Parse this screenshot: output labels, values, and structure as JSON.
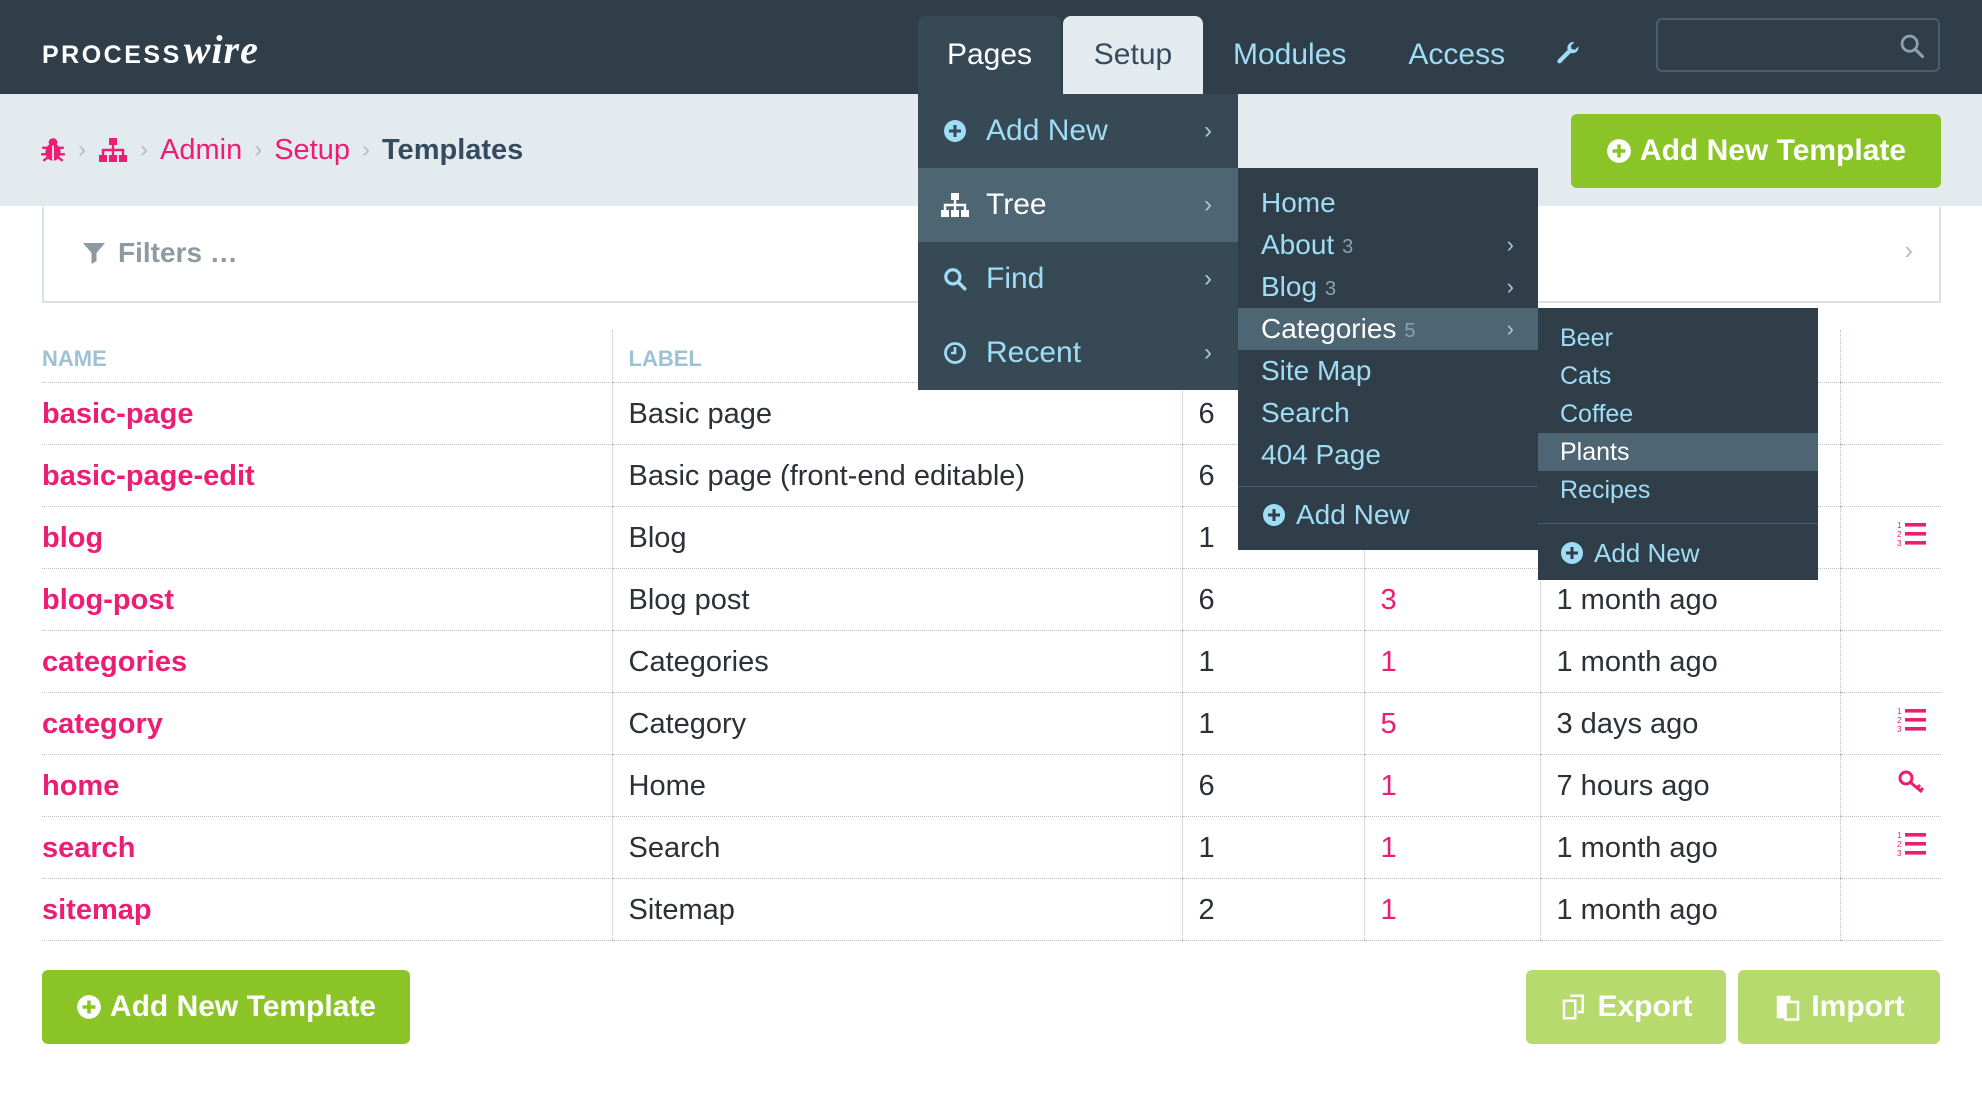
{
  "app": {
    "logo_main": "PROCESS",
    "logo_accent": "wire"
  },
  "topnav": {
    "pages": "Pages",
    "setup": "Setup",
    "modules": "Modules",
    "access": "Access",
    "tools_icon": "wrench-icon"
  },
  "search": {
    "placeholder": "",
    "icon": "search-icon"
  },
  "breadcrumbs": {
    "items": [
      "Admin",
      "Setup"
    ],
    "current": "Templates",
    "icons": [
      "bug-icon",
      "sitemap-icon"
    ]
  },
  "actions": {
    "add_new_template": "Add New Template",
    "export": "Export",
    "import": "Import"
  },
  "filters": {
    "label": "Filters …"
  },
  "table": {
    "columns": [
      "NAME",
      "LABEL",
      "",
      "",
      "",
      ""
    ],
    "rows": [
      {
        "name": "basic-page",
        "label": "Basic page",
        "fields": "6",
        "pages": "",
        "modified": "",
        "icon": ""
      },
      {
        "name": "basic-page-edit",
        "label": "Basic page (front-end editable)",
        "fields": "6",
        "pages": "",
        "modified": "",
        "icon": ""
      },
      {
        "name": "blog",
        "label": "Blog",
        "fields": "1",
        "pages": "",
        "modified": "",
        "icon": "list-ol-icon"
      },
      {
        "name": "blog-post",
        "label": "Blog post",
        "fields": "6",
        "pages": "3",
        "modified": "1 month ago",
        "icon": ""
      },
      {
        "name": "categories",
        "label": "Categories",
        "fields": "1",
        "pages": "1",
        "modified": "1 month ago",
        "icon": ""
      },
      {
        "name": "category",
        "label": "Category",
        "fields": "1",
        "pages": "5",
        "modified": "3 days ago",
        "icon": "list-ol-icon"
      },
      {
        "name": "home",
        "label": "Home",
        "fields": "6",
        "pages": "1",
        "modified": "7 hours ago",
        "icon": "key-icon"
      },
      {
        "name": "search",
        "label": "Search",
        "fields": "1",
        "pages": "1",
        "modified": "1 month ago",
        "icon": "list-ol-icon"
      },
      {
        "name": "sitemap",
        "label": "Sitemap",
        "fields": "2",
        "pages": "1",
        "modified": "1 month ago",
        "icon": ""
      }
    ]
  },
  "pages_menu": {
    "items": [
      {
        "label": "Add New",
        "icon": "plus-circle-icon"
      },
      {
        "label": "Tree",
        "icon": "sitemap-icon"
      },
      {
        "label": "Find",
        "icon": "search-icon"
      },
      {
        "label": "Recent",
        "icon": "clock-icon"
      }
    ]
  },
  "tree_menu": {
    "items": [
      {
        "label": "Home",
        "count": ""
      },
      {
        "label": "About",
        "count": "3"
      },
      {
        "label": "Blog",
        "count": "3"
      },
      {
        "label": "Categories",
        "count": "5"
      },
      {
        "label": "Site Map",
        "count": ""
      },
      {
        "label": "Search",
        "count": ""
      },
      {
        "label": "404 Page",
        "count": ""
      }
    ],
    "add_new": "Add New"
  },
  "categories_menu": {
    "items": [
      "Beer",
      "Cats",
      "Coffee",
      "Plants",
      "Recipes"
    ],
    "add_new": "Add New"
  },
  "colors": {
    "masthead": "#2f3e48",
    "accent_pink": "#eb1d75",
    "link_blue": "#9fdcf6",
    "button_green": "#8ac426",
    "button_light_green": "#b6da6e",
    "header_bg": "#e4ebee"
  }
}
